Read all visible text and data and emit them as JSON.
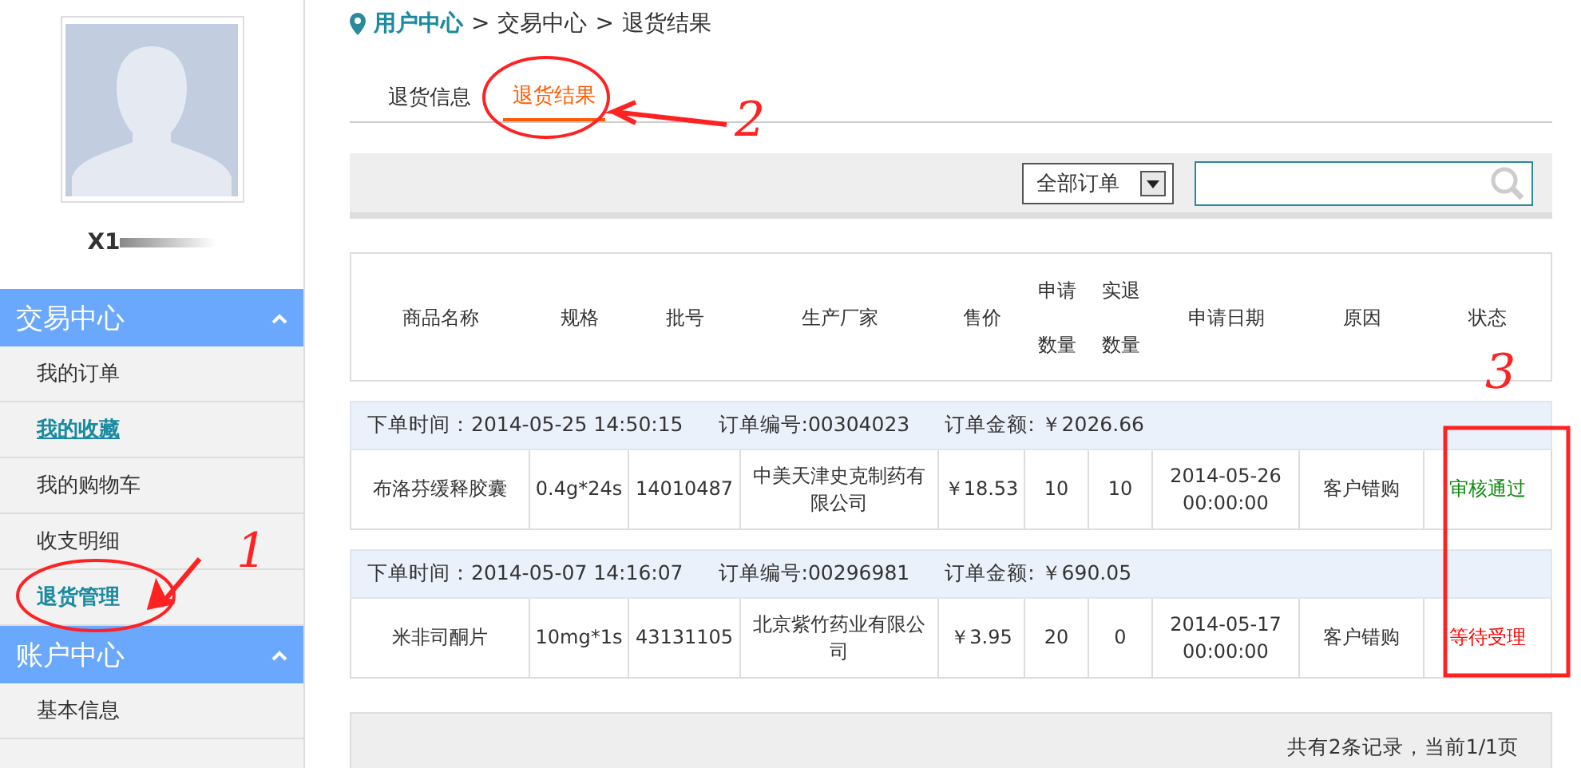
{
  "sidebar": {
    "username": "X1",
    "sections": [
      {
        "title": "交易中心",
        "expanded": true,
        "items": [
          {
            "label": "我的订单",
            "selected": false,
            "underlined": false
          },
          {
            "label": "我的收藏",
            "selected": false,
            "underlined": true
          },
          {
            "label": "我的购物车",
            "selected": false,
            "underlined": false
          },
          {
            "label": "收支明细",
            "selected": false,
            "underlined": false
          },
          {
            "label": "退货管理",
            "selected": true,
            "underlined": false
          }
        ]
      },
      {
        "title": "账户中心",
        "expanded": true,
        "items": [
          {
            "label": "基本信息",
            "selected": false,
            "underlined": false
          }
        ]
      }
    ]
  },
  "breadcrumb": [
    {
      "kind": "home",
      "text": "用户中心"
    },
    {
      "kind": "sep",
      "text": ">"
    },
    {
      "kind": "crumb",
      "text": "交易中心"
    },
    {
      "kind": "sep",
      "text": ">"
    },
    {
      "kind": "crumb",
      "text": "退货结果"
    }
  ],
  "tabs": [
    {
      "label": "退货信息",
      "selected": false
    },
    {
      "label": "退货结果",
      "selected": true
    }
  ],
  "toolbar": {
    "filter": "全部订单"
  },
  "table": {
    "columns": [
      "商品名称",
      "规格",
      "批号",
      "生产厂家",
      "售价",
      "申请数量",
      "实退数量",
      "申请日期",
      "原因",
      "状态"
    ],
    "orders": [
      {
        "time": "下单时间：2014-05-25 14:50:15",
        "number": "订单编号:00304023",
        "amount": "订单金额: ￥2026.66",
        "cells": [
          "布洛芬缓释胶囊",
          "0.4g*24s",
          "14010487",
          "中美天津史克制药有限公司",
          "￥18.53",
          "10",
          "10",
          "2014-05-26 00:00:00",
          "客户错购"
        ],
        "status": "审核通过",
        "color": "#0a8a0a"
      },
      {
        "time": "下单时间：2014-05-07 14:16:07",
        "number": "订单编号:00296981",
        "amount": "订单金额: ￥690.05",
        "cells": [
          "米非司酮片",
          "10mg*1s",
          "43131105",
          "北京紫竹药业有限公司",
          "￥3.95",
          "20",
          "0",
          "2014-05-17 00:00:00",
          "客户错购"
        ],
        "status": "等待受理",
        "color": "#ff0000"
      }
    ]
  },
  "footer": "共有2条记录，当前1/1页",
  "annotations": [
    "1",
    "2",
    "3"
  ]
}
